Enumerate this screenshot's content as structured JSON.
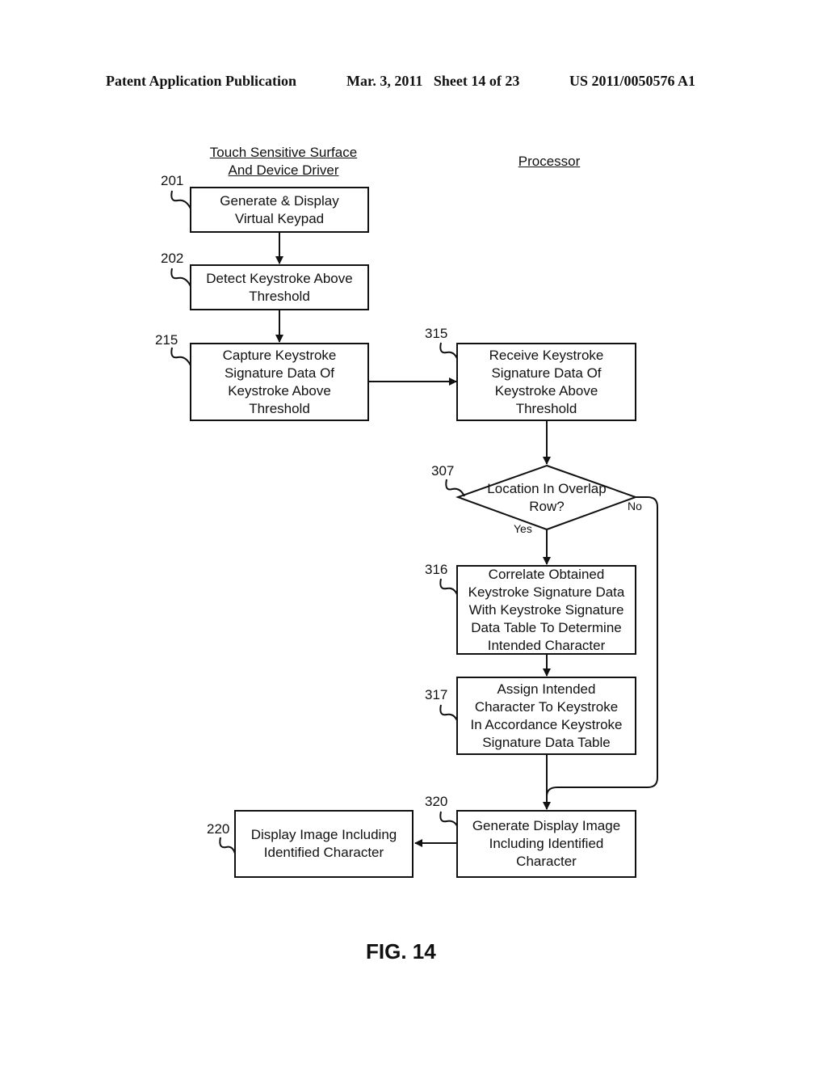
{
  "header": {
    "publication": "Patent Application Publication",
    "date_sheet": "Mar. 3, 2011   Sheet 14 of 23",
    "number": "US 2011/0050576 A1"
  },
  "lanes": {
    "left": [
      "Touch Sensitive Surface",
      "And Device Driver"
    ],
    "right": "Processor"
  },
  "steps": {
    "s201": {
      "ref": "201",
      "lines": [
        "Generate & Display",
        "Virtual Keypad"
      ]
    },
    "s202": {
      "ref": "202",
      "lines": [
        "Detect Keystroke Above",
        "Threshold"
      ]
    },
    "s215": {
      "ref": "215",
      "lines": [
        "Capture Keystroke",
        "Signature Data Of",
        "Keystroke Above",
        "Threshold"
      ]
    },
    "s315": {
      "ref": "315",
      "lines": [
        "Receive Keystroke",
        "Signature Data Of",
        "Keystroke Above",
        "Threshold"
      ]
    },
    "s307": {
      "ref": "307",
      "lines": [
        "Location In Overlap",
        "Row?"
      ],
      "yes": "Yes",
      "no": "No"
    },
    "s316": {
      "ref": "316",
      "lines": [
        "Correlate Obtained",
        "Keystroke Signature Data",
        "With Keystroke Signature",
        "Data Table To Determine",
        "Intended Character"
      ]
    },
    "s317": {
      "ref": "317",
      "lines": [
        "Assign Intended",
        "Character To Keystroke",
        "In Accordance Keystroke",
        "Signature Data Table"
      ]
    },
    "s320": {
      "ref": "320",
      "lines": [
        "Generate Display Image",
        "Including Identified",
        "Character"
      ]
    },
    "s220": {
      "ref": "220",
      "lines": [
        "Display Image Including",
        "Identified Character"
      ]
    }
  },
  "figure_label": "FIG. 14"
}
